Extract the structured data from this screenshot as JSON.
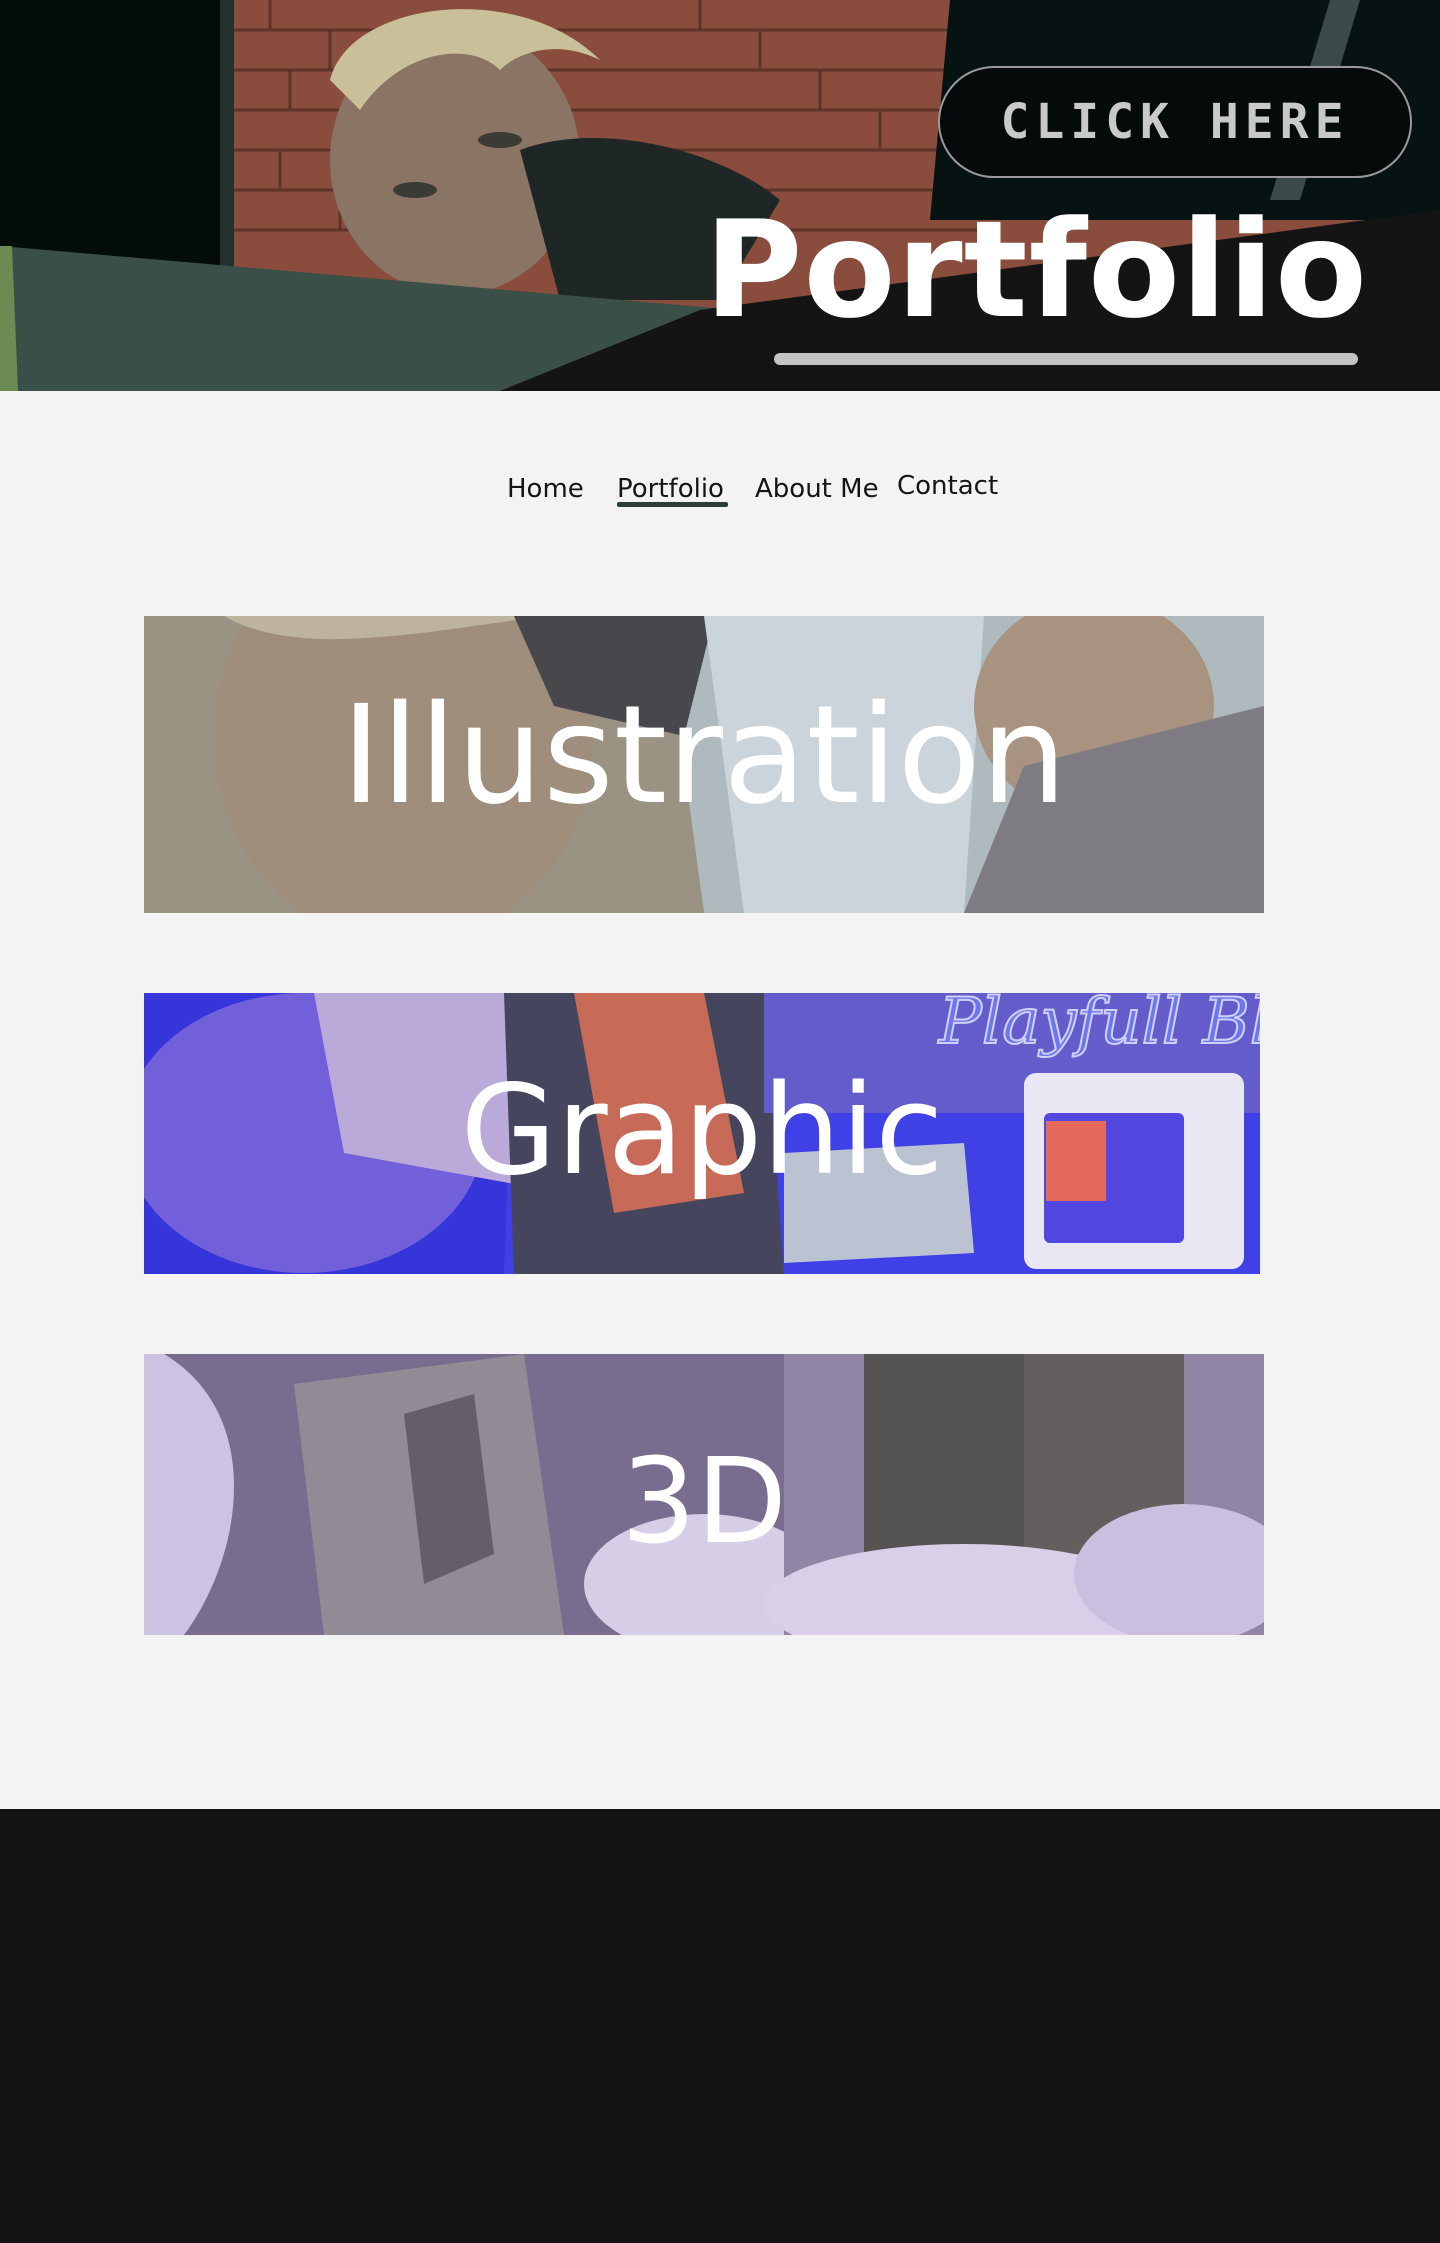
{
  "hero": {
    "cta_label": "CLICK HERE",
    "title": "Portfolio"
  },
  "nav": {
    "items": [
      {
        "label": "Home"
      },
      {
        "label": "Portfolio",
        "active": true
      },
      {
        "label": "About Me"
      },
      {
        "label": "Contact"
      }
    ]
  },
  "categories": [
    {
      "label": "Illustration"
    },
    {
      "label": "Graphic"
    },
    {
      "label": "3D"
    }
  ],
  "colors": {
    "background": "#f3f3f3",
    "dark": "#141414",
    "nav_active_underline": "#2e3c3a"
  }
}
